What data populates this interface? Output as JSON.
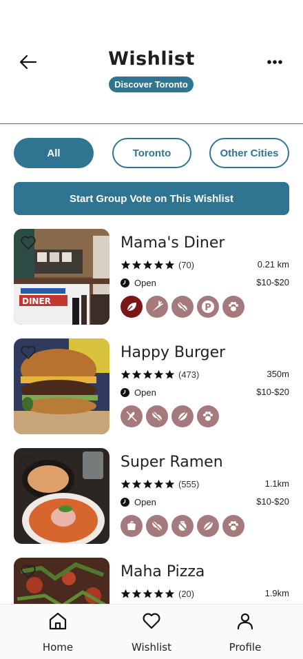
{
  "header": {
    "title": "Wishlist",
    "subtitle": "Discover Toronto",
    "back_icon": "arrow-left-icon",
    "more_icon": "more-horizontal-icon"
  },
  "filters": {
    "items": [
      {
        "label": "All",
        "active": true
      },
      {
        "label": "Toronto",
        "active": false
      },
      {
        "label": "Other Cities",
        "active": false
      }
    ]
  },
  "group_vote": {
    "label": "Start Group Vote on This Wishlist"
  },
  "restaurants": [
    {
      "name": "Mama's Diner",
      "rating": 5,
      "reviews": "(70)",
      "distance": "0.21 km",
      "status": "Open",
      "price": "$10-$20",
      "amenities": [
        "vegan-leaf-icon",
        "carrot-icon",
        "gluten-free-icon",
        "parking-icon",
        "pet-friendly-icon"
      ]
    },
    {
      "name": "Happy Burger",
      "rating": 5,
      "reviews": "(473)",
      "distance": "350m",
      "status": "Open",
      "price": "$10-$20",
      "amenities": [
        "wheat-free-icon",
        "gluten-free-icon",
        "vegetarian-icon",
        "pet-friendly-icon"
      ]
    },
    {
      "name": "Super Ramen",
      "rating": 5,
      "reviews": "(555)",
      "distance": "1.1km",
      "status": "Open",
      "price": "$10-$20",
      "amenities": [
        "halal-icon",
        "gluten-free-icon",
        "nut-free-icon",
        "vegetarian-icon",
        "pet-friendly-icon"
      ]
    },
    {
      "name": "Maha Pizza",
      "rating": 5,
      "reviews": "(20)",
      "distance": "1.9km"
    }
  ],
  "nav": {
    "home": "Home",
    "wishlist": "Wishlist",
    "profile": "Profile"
  },
  "colors": {
    "primary": "#2f7591",
    "amenity": "#a57a7c",
    "amenity_highlight": "#7a1717"
  }
}
